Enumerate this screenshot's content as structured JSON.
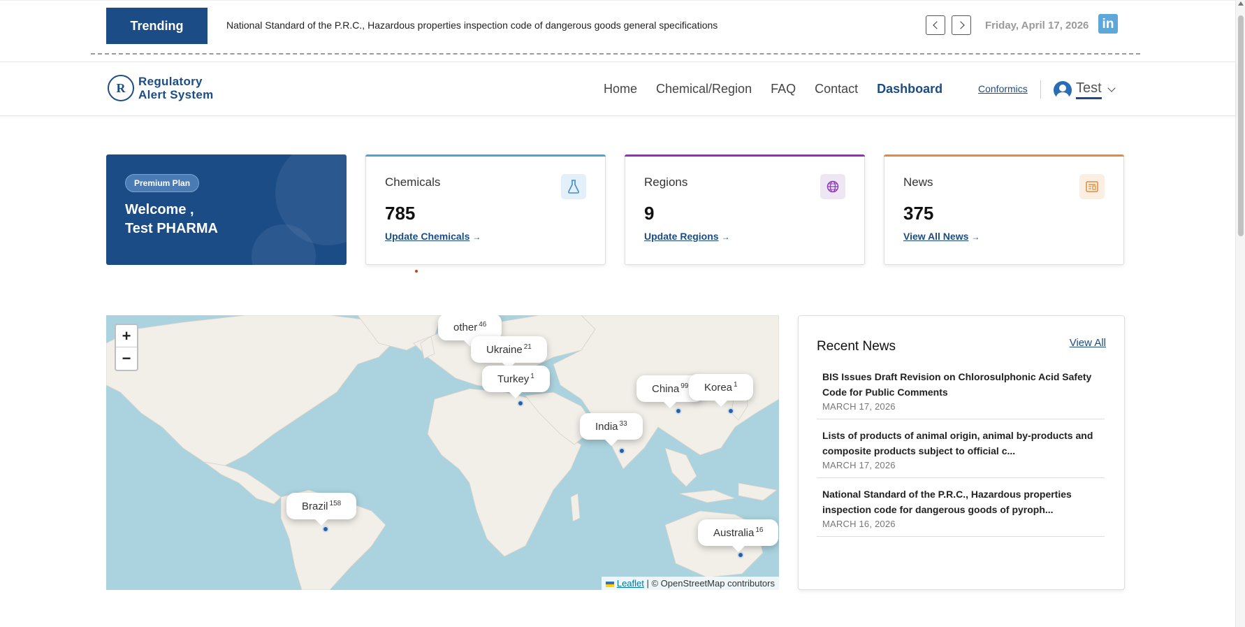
{
  "trending": {
    "badge": "Trending",
    "headline": "National Standard of the P.R.C., Hazardous properties inspection code of dangerous goods general specifications",
    "date": "Friday, April 17, 2026",
    "linkedin_glyph": "in"
  },
  "header": {
    "logo_line1": "Regulatory",
    "logo_line2": "Alert System",
    "logo_mark": "R",
    "nav": [
      "Home",
      "Chemical/Region",
      "FAQ",
      "Contact",
      "Dashboard"
    ],
    "active_nav": "Dashboard",
    "conformics": "Conformics",
    "user": "Test"
  },
  "welcome": {
    "plan": "Premium Plan",
    "line1": "Welcome ,",
    "line2": "Test PHARMA"
  },
  "stats": {
    "chemicals": {
      "label": "Chemicals",
      "value": "785",
      "link": "Update Chemicals",
      "icon": "flask-icon",
      "color": "#4da3d8"
    },
    "regions": {
      "label": "Regions",
      "value": "9",
      "link": "Update Regions",
      "icon": "globe-icon",
      "color": "#9b2bbf"
    },
    "news": {
      "label": "News",
      "value": "375",
      "link": "View All News",
      "icon": "newspaper-icon",
      "color": "#e58a3c"
    }
  },
  "map": {
    "zoom_in": "+",
    "zoom_out": "−",
    "attribution_leaflet": "Leaflet",
    "attribution_rest": " | © OpenStreetMap contributors",
    "popups": [
      {
        "name": "other",
        "count": "46"
      },
      {
        "name": "Ukraine",
        "count": "21"
      },
      {
        "name": "Turkey",
        "count": "1"
      },
      {
        "name": "China",
        "count": "99"
      },
      {
        "name": "Korea",
        "count": "1"
      },
      {
        "name": "India",
        "count": "33"
      },
      {
        "name": "Brazil",
        "count": "158"
      },
      {
        "name": "Australia",
        "count": "16"
      }
    ]
  },
  "recent_news": {
    "title": "Recent News",
    "view_all": "View All",
    "items": [
      {
        "title": "BIS Issues Draft Revision on Chlorosulphonic Acid Safety Code for Public Comments",
        "date": "MARCH 17, 2026"
      },
      {
        "title": "Lists of products of animal origin, animal by-products and composite products subject to official c...",
        "date": "MARCH 17, 2026"
      },
      {
        "title": "National Standard of the P.R.C., Hazardous properties inspection code for dangerous goods of pyroph...",
        "date": "MARCH 16, 2026"
      }
    ]
  }
}
